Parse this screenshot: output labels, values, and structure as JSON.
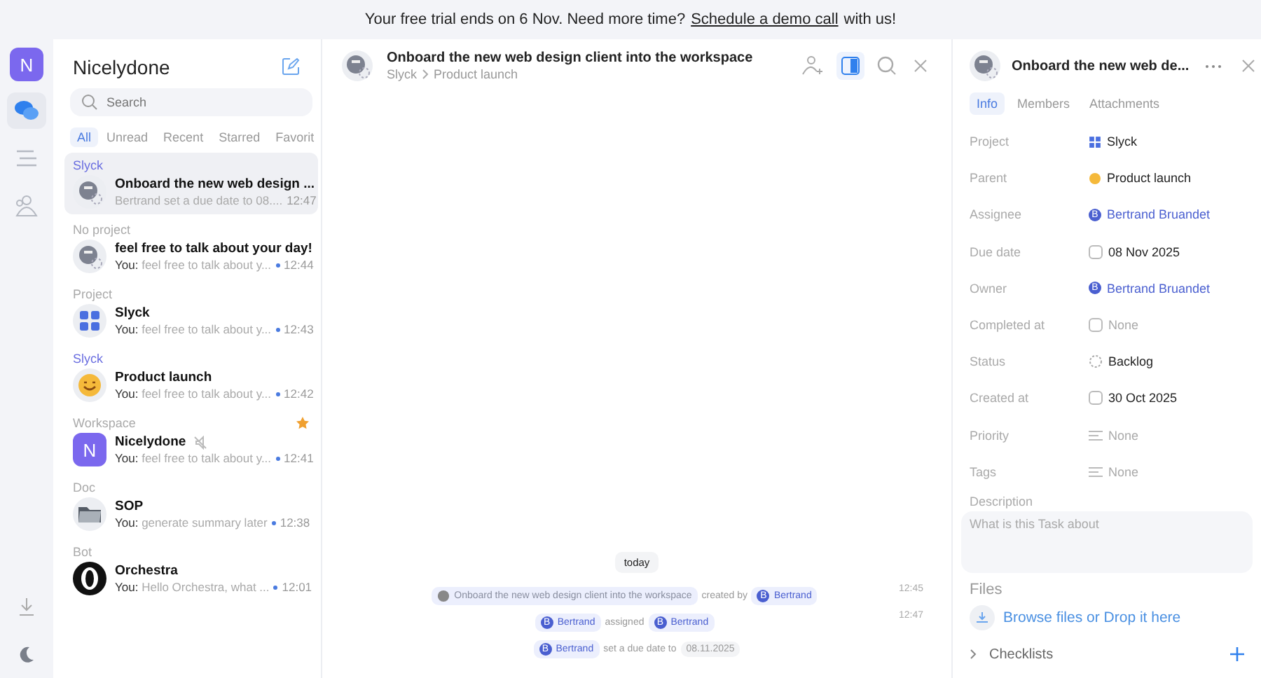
{
  "banner": {
    "text": "Your free trial ends on 6 Nov. Need more time?",
    "link": "Schedule a demo call",
    "suffix": "with us!"
  },
  "rail": {
    "avatar": "N",
    "items": [
      {
        "kind": "chat",
        "selected": true
      },
      {
        "kind": "list",
        "selected": false
      },
      {
        "kind": "people",
        "selected": false
      }
    ],
    "bottom": [
      {
        "kind": "download"
      },
      {
        "kind": "moon"
      }
    ]
  },
  "sidebar": {
    "title": "Nicelydone",
    "search_placeholder": "Search",
    "filters": [
      {
        "label": "All",
        "selected": true
      },
      {
        "label": "Unread",
        "selected": false
      },
      {
        "label": "Recent",
        "selected": false
      },
      {
        "label": "Starred",
        "selected": false
      },
      {
        "label": "Favorit",
        "selected": false
      }
    ],
    "chats": [
      {
        "category": "Slyck",
        "category_linked": true,
        "kind": "task",
        "title": "Onboard the new web design ...",
        "preview": "Bertrand set a due date to 08....",
        "time": "12:47",
        "unread": false,
        "selected": true,
        "starred": false,
        "muted": false
      },
      {
        "category": "No project",
        "category_linked": false,
        "kind": "task",
        "title": "feel free to talk about your day!",
        "preview": "**You:** feel free to talk about y...",
        "time": "12:44",
        "unread": true,
        "selected": false,
        "starred": false,
        "muted": false
      },
      {
        "category": "Project",
        "category_linked": false,
        "kind": "project",
        "title": "Slyck",
        "preview": "**You:** feel free to talk about y...",
        "time": "12:43",
        "unread": true,
        "selected": false,
        "starred": false,
        "muted": false
      },
      {
        "category": "Slyck",
        "category_linked": true,
        "kind": "emoji",
        "title": "Product launch",
        "preview": "**You:** feel free to talk about y...",
        "time": "12:42",
        "unread": true,
        "selected": false,
        "starred": false,
        "muted": false
      },
      {
        "category": "Workspace",
        "category_linked": false,
        "kind": "workspace",
        "avatar_text": "N",
        "title": "Nicelydone",
        "preview": "**You:** feel free to talk about y...",
        "time": "12:41",
        "unread": true,
        "selected": false,
        "starred": true,
        "muted": true
      },
      {
        "category": "Doc",
        "category_linked": false,
        "kind": "folder",
        "title": "SOP",
        "preview": "**You:** generate summary later",
        "time": "12:38",
        "unread": true,
        "selected": false,
        "starred": false,
        "muted": false
      },
      {
        "category": "Bot",
        "category_linked": false,
        "kind": "bot",
        "title": "Orchestra",
        "preview": "**You:** Hello Orchestra, what ...",
        "time": "12:01",
        "unread": true,
        "selected": false,
        "starred": false,
        "muted": false
      }
    ]
  },
  "chat": {
    "title": "Onboard the new web design client into the workspace",
    "breadcrumb": [
      "Slyck",
      "Product launch"
    ],
    "panel_open": true,
    "day": "today",
    "events": [
      {
        "time": "12:45",
        "segments": [
          {
            "kind": "task",
            "text": "Onboard the new web design client into the workspace"
          },
          {
            "kind": "text",
            "text": "created by"
          },
          {
            "kind": "user",
            "initial": "B",
            "text": "Bertrand"
          }
        ]
      },
      {
        "time": "12:47",
        "segments": [
          {
            "kind": "user",
            "initial": "B",
            "text": "Bertrand"
          },
          {
            "kind": "text",
            "text": "assigned"
          },
          {
            "kind": "user",
            "initial": "B",
            "text": "Bertrand"
          }
        ]
      },
      {
        "segments": [
          {
            "kind": "user",
            "initial": "B",
            "text": "Bertrand"
          },
          {
            "kind": "text",
            "text": "set a due date to"
          },
          {
            "kind": "date",
            "text": "08.11.2025"
          }
        ]
      }
    ]
  },
  "details": {
    "title": "Onboard the new web de...",
    "tabs": [
      {
        "label": "Info",
        "selected": true
      },
      {
        "label": "Members",
        "selected": false
      },
      {
        "label": "Attachments",
        "selected": false
      }
    ],
    "fields": [
      {
        "label": "Project",
        "kind": "project",
        "value": "Slyck"
      },
      {
        "label": "Parent",
        "kind": "emoji",
        "value": "Product launch"
      },
      {
        "label": "Assignee",
        "kind": "user",
        "initial": "B",
        "value": "Bertrand Bruandet"
      },
      {
        "label": "Due date",
        "kind": "date",
        "value": "08 Nov 2025"
      },
      {
        "label": "Owner",
        "kind": "user",
        "initial": "B",
        "value": "Bertrand Bruandet"
      },
      {
        "label": "Completed at",
        "kind": "empty_date",
        "value": "None"
      },
      {
        "label": "Status",
        "kind": "status",
        "value": "Backlog"
      },
      {
        "label": "Created at",
        "kind": "date",
        "value": "30 Oct 2025"
      },
      {
        "label": "Priority",
        "kind": "priority",
        "value": "None"
      },
      {
        "label": "Tags",
        "kind": "tags",
        "value": "None"
      }
    ],
    "description_label": "Description",
    "description_placeholder": "What is this Task about",
    "files_label": "Files",
    "files_action": "Browse files or Drop it here",
    "checklists_label": "Checklists"
  }
}
